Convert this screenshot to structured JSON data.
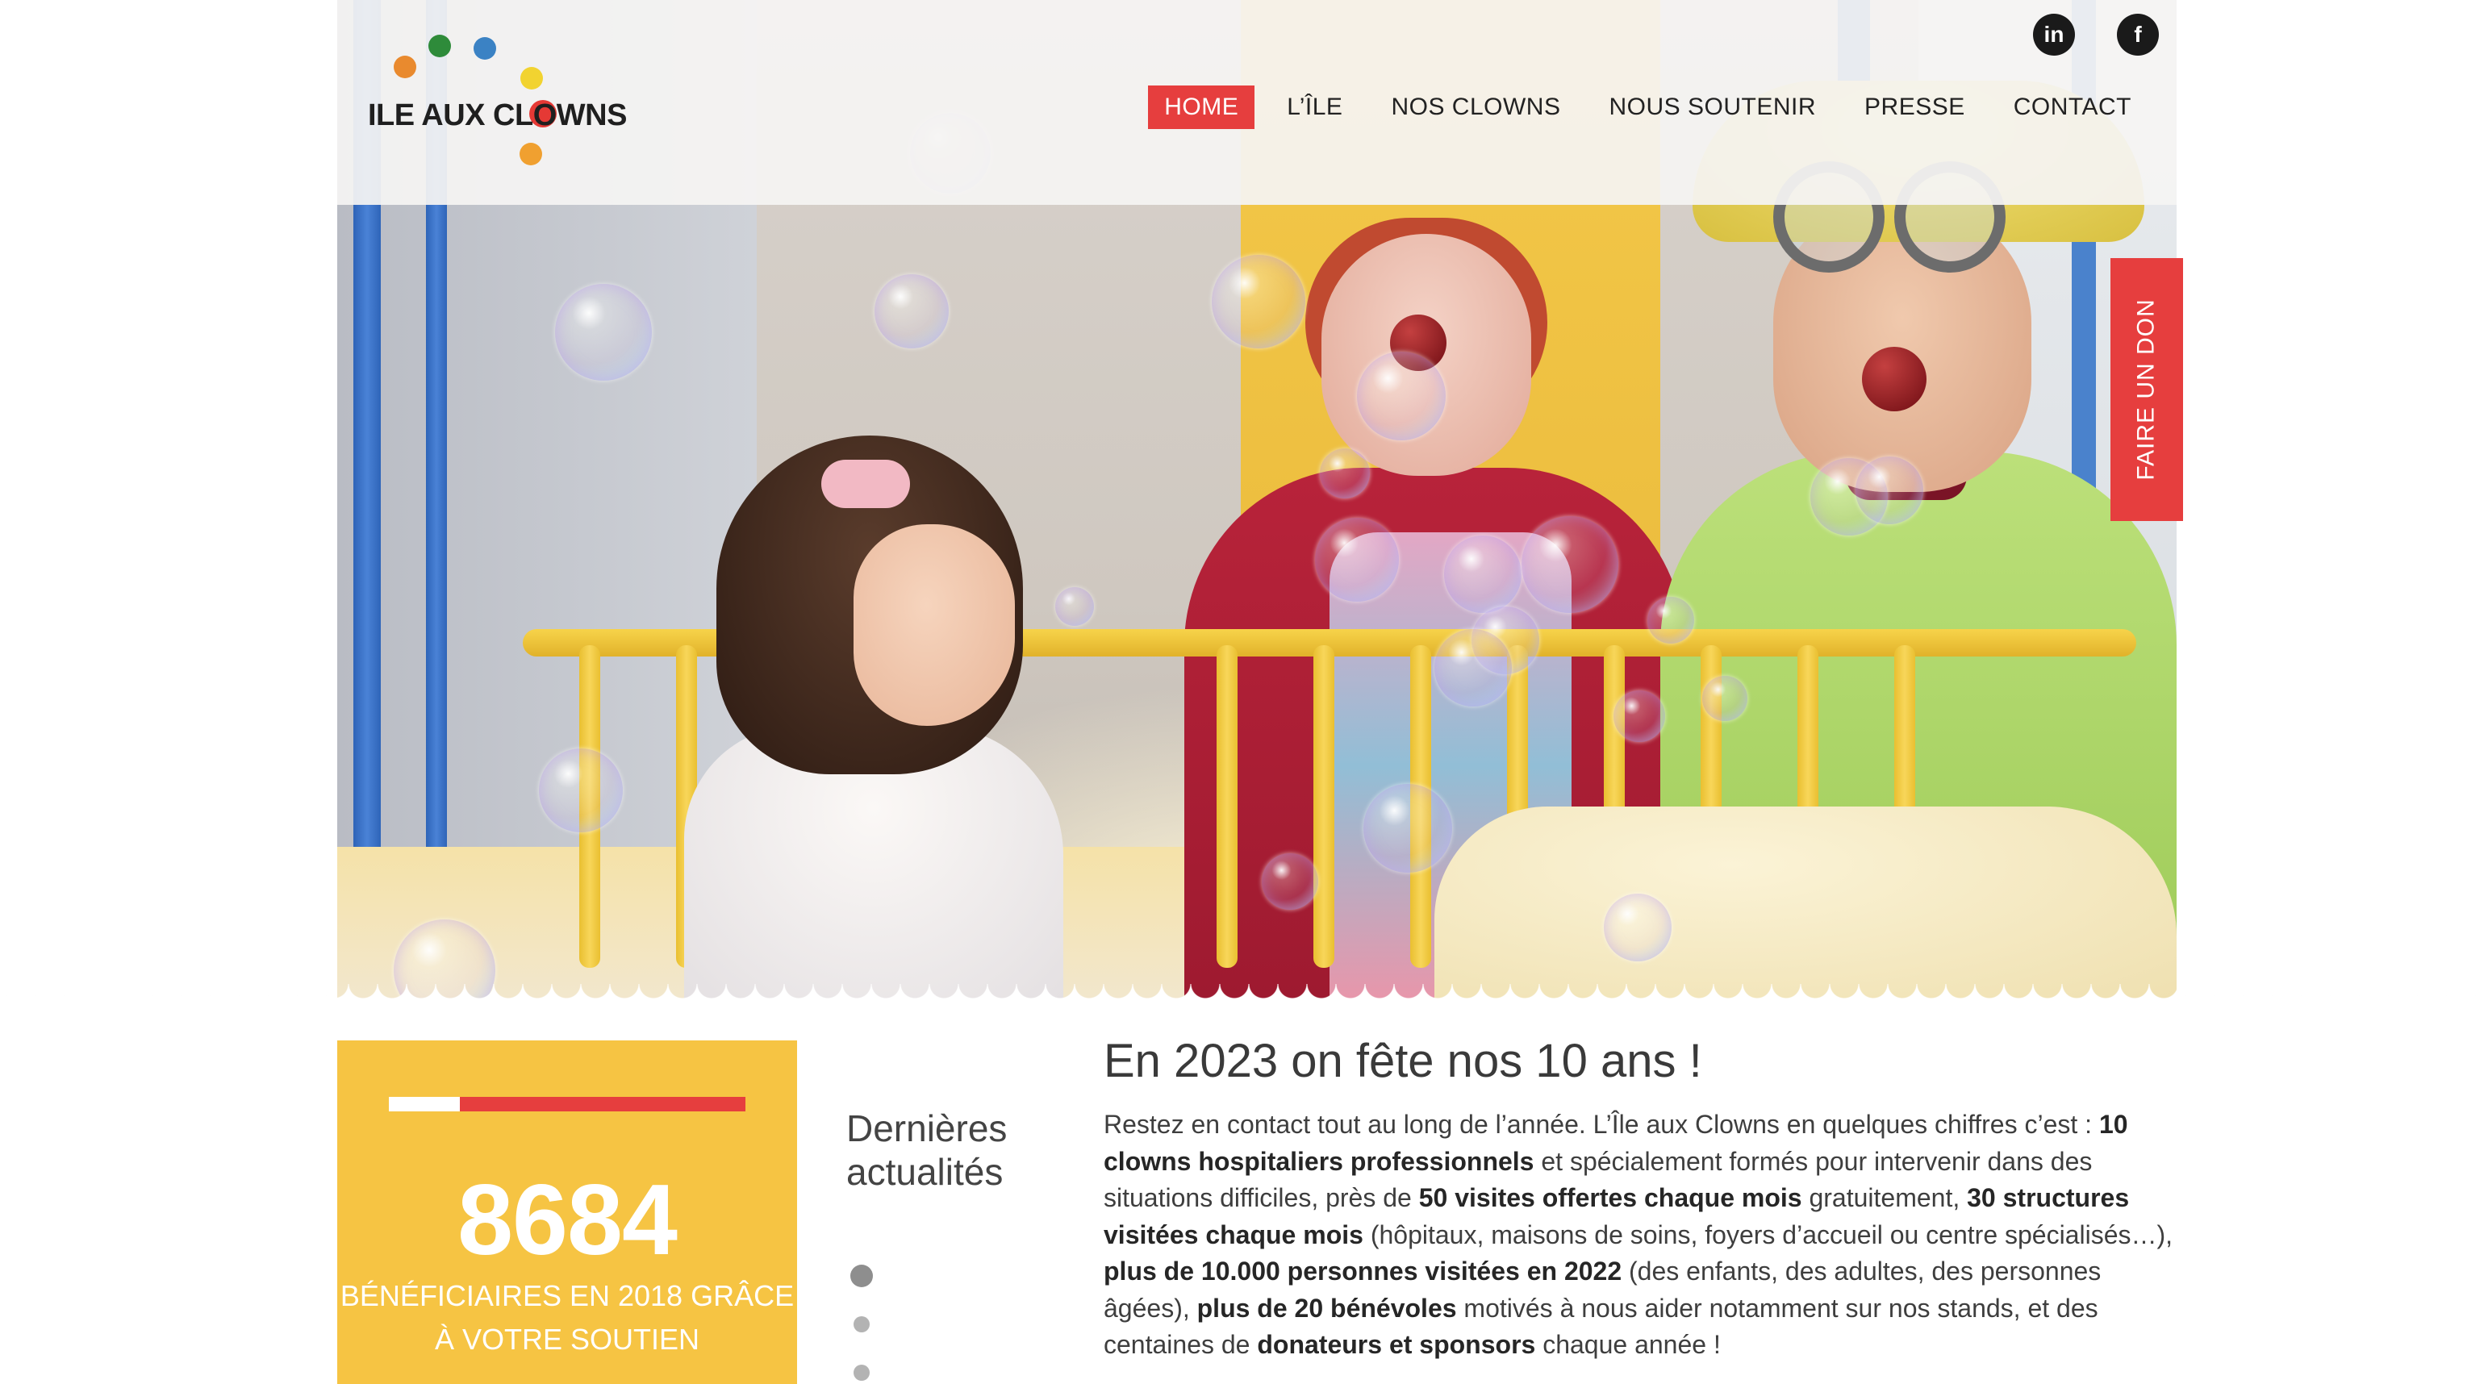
{
  "brand": {
    "logo_text": "ILE AUX CLOWNS",
    "logo_colors": [
      "#e98a2e",
      "#2e8b3a",
      "#3b82c4",
      "#f2d330",
      "#f0a030",
      "#e53935"
    ]
  },
  "social": [
    {
      "label": "in",
      "icon": "linkedin-icon"
    },
    {
      "label": "f",
      "icon": "facebook-icon"
    }
  ],
  "nav": {
    "items": [
      {
        "label": "HOME",
        "active": true
      },
      {
        "label": "L’ÎLE",
        "active": false
      },
      {
        "label": "NOS CLOWNS",
        "active": false
      },
      {
        "label": "NOUS SOUTENIR",
        "active": false
      },
      {
        "label": "PRESSE",
        "active": false
      },
      {
        "label": "CONTACT",
        "active": false
      }
    ]
  },
  "donate_tab": {
    "label": "FAIRE UN DON"
  },
  "stats": {
    "progress": 0.2,
    "number": "8684",
    "caption_line1": "BÉNÉFICIAIRES EN 2018 GRÂCE",
    "caption_line2": "À VOTRE SOUTIEN"
  },
  "news": {
    "title_line1": "Dernières",
    "title_line2": "actualités",
    "slides": 3,
    "active_slide": 0
  },
  "article": {
    "title": "En 2023 on fête nos 10 ans !",
    "body": [
      {
        "t": "Restez en contact tout au long de l’année. L’Île aux Clowns en quelques chiffres c’est : ",
        "b": false
      },
      {
        "t": "10 clowns hospitaliers professionnels",
        "b": true
      },
      {
        "t": " et spécialement formés pour intervenir dans des situations difficiles,  près de ",
        "b": false
      },
      {
        "t": "50 visites offertes chaque mois",
        "b": true
      },
      {
        "t": " gratuitement, ",
        "b": false
      },
      {
        "t": "30 structures visitées chaque mois",
        "b": true
      },
      {
        "t": " (hôpitaux, maisons de soins, foyers d’accueil ou centre spécialisés…), ",
        "b": false
      },
      {
        "t": "plus de 10.000 personnes visitées en 2022",
        "b": true
      },
      {
        "t": " (des enfants, des adultes, des personnes âgées), ",
        "b": false
      },
      {
        "t": "plus de 20 bénévoles",
        "b": true
      },
      {
        "t": " motivés à nous aider notamment sur nos stands, et des centaines de ",
        "b": false
      },
      {
        "t": "donateurs et sponsors",
        "b": true
      },
      {
        "t": " chaque année !",
        "b": false
      }
    ]
  },
  "colors": {
    "accent_red": "#e63e3e",
    "stats_yellow": "#f6c443",
    "text_dark": "#3a3a3a"
  }
}
